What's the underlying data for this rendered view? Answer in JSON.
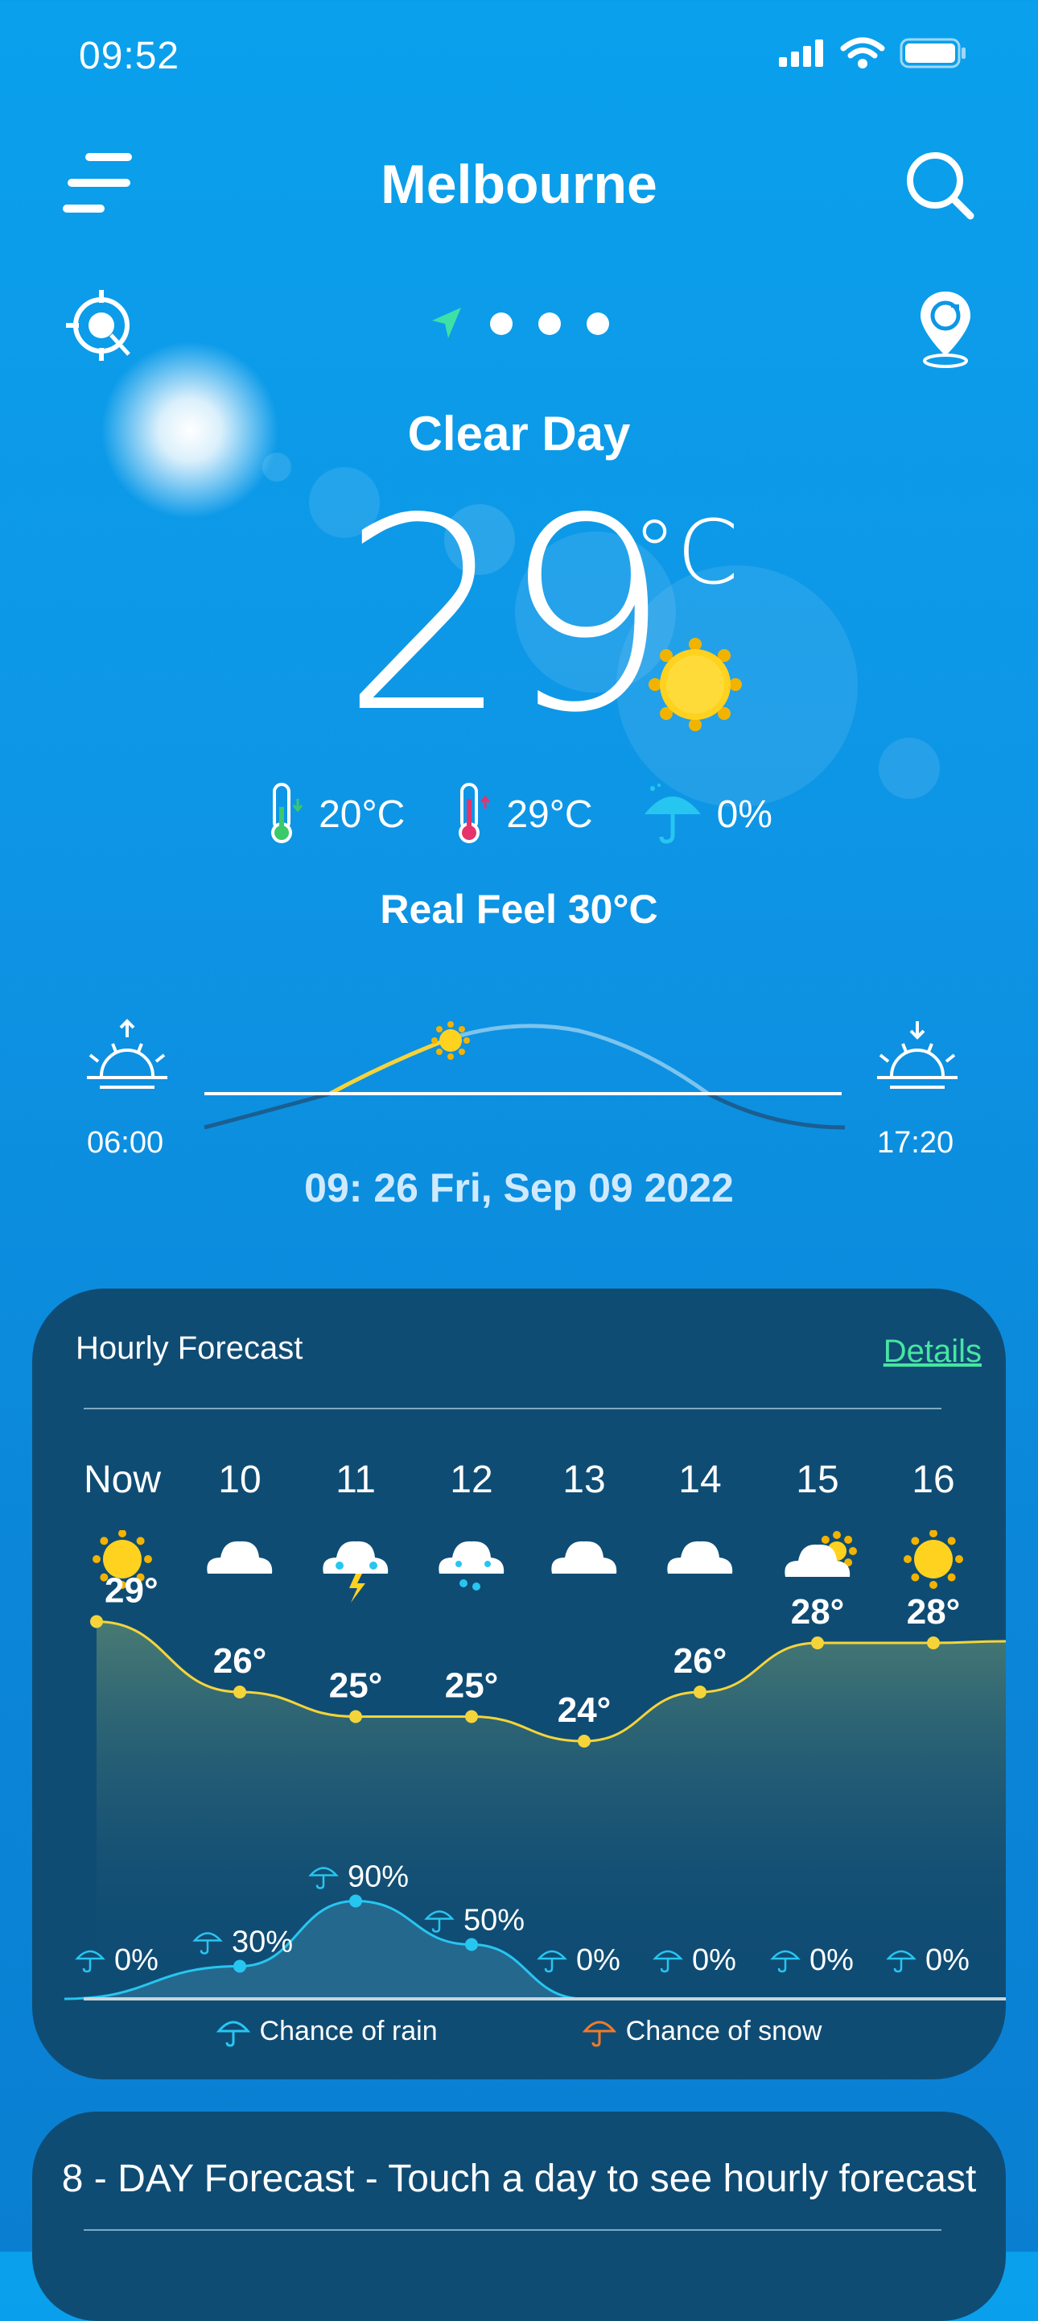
{
  "status_bar": {
    "time": "09:52"
  },
  "header": {
    "city": "Melbourne"
  },
  "current": {
    "condition": "Clear Day",
    "temperature": "29",
    "unit": "°C",
    "min_temp": "20°C",
    "max_temp": "29°C",
    "precip_chance": "0%",
    "real_feel": "Real Feel 30°C"
  },
  "sun": {
    "sunrise": "06:00",
    "sunset": "17:20",
    "datetime": "09: 26 Fri, Sep 09 2022"
  },
  "hourly": {
    "title": "Hourly Forecast",
    "details_label": "Details",
    "hours": [
      "Now",
      "10",
      "11",
      "12",
      "13",
      "14",
      "15",
      "16"
    ],
    "icons": [
      "sun-icon",
      "cloud-icon",
      "thunderstorm-icon",
      "rain-cloud-icon",
      "cloud-icon",
      "cloud-icon",
      "partly-cloudy-icon",
      "sun-icon"
    ],
    "temps": [
      "29°",
      "26°",
      "25°",
      "25°",
      "24°",
      "26°",
      "28°",
      "28°"
    ],
    "temp_values": [
      29,
      26,
      25,
      25,
      24,
      26,
      28,
      28
    ],
    "rain": [
      "0%",
      "30%",
      "90%",
      "50%",
      "0%",
      "0%",
      "0%",
      "0%"
    ],
    "rain_values": [
      0,
      30,
      90,
      50,
      0,
      0,
      0,
      0
    ],
    "legend_rain": "Chance of rain",
    "legend_snow": "Chance of snow"
  },
  "daily": {
    "title": "8 - DAY Forecast - Touch a day to see hourly forecast"
  },
  "colors": {
    "temp_line": "#f5d43a",
    "rain_line": "#27c6f0",
    "snow_icon": "#f07a2a",
    "details_link": "#47e6a0",
    "card": "#0f4c74"
  }
}
